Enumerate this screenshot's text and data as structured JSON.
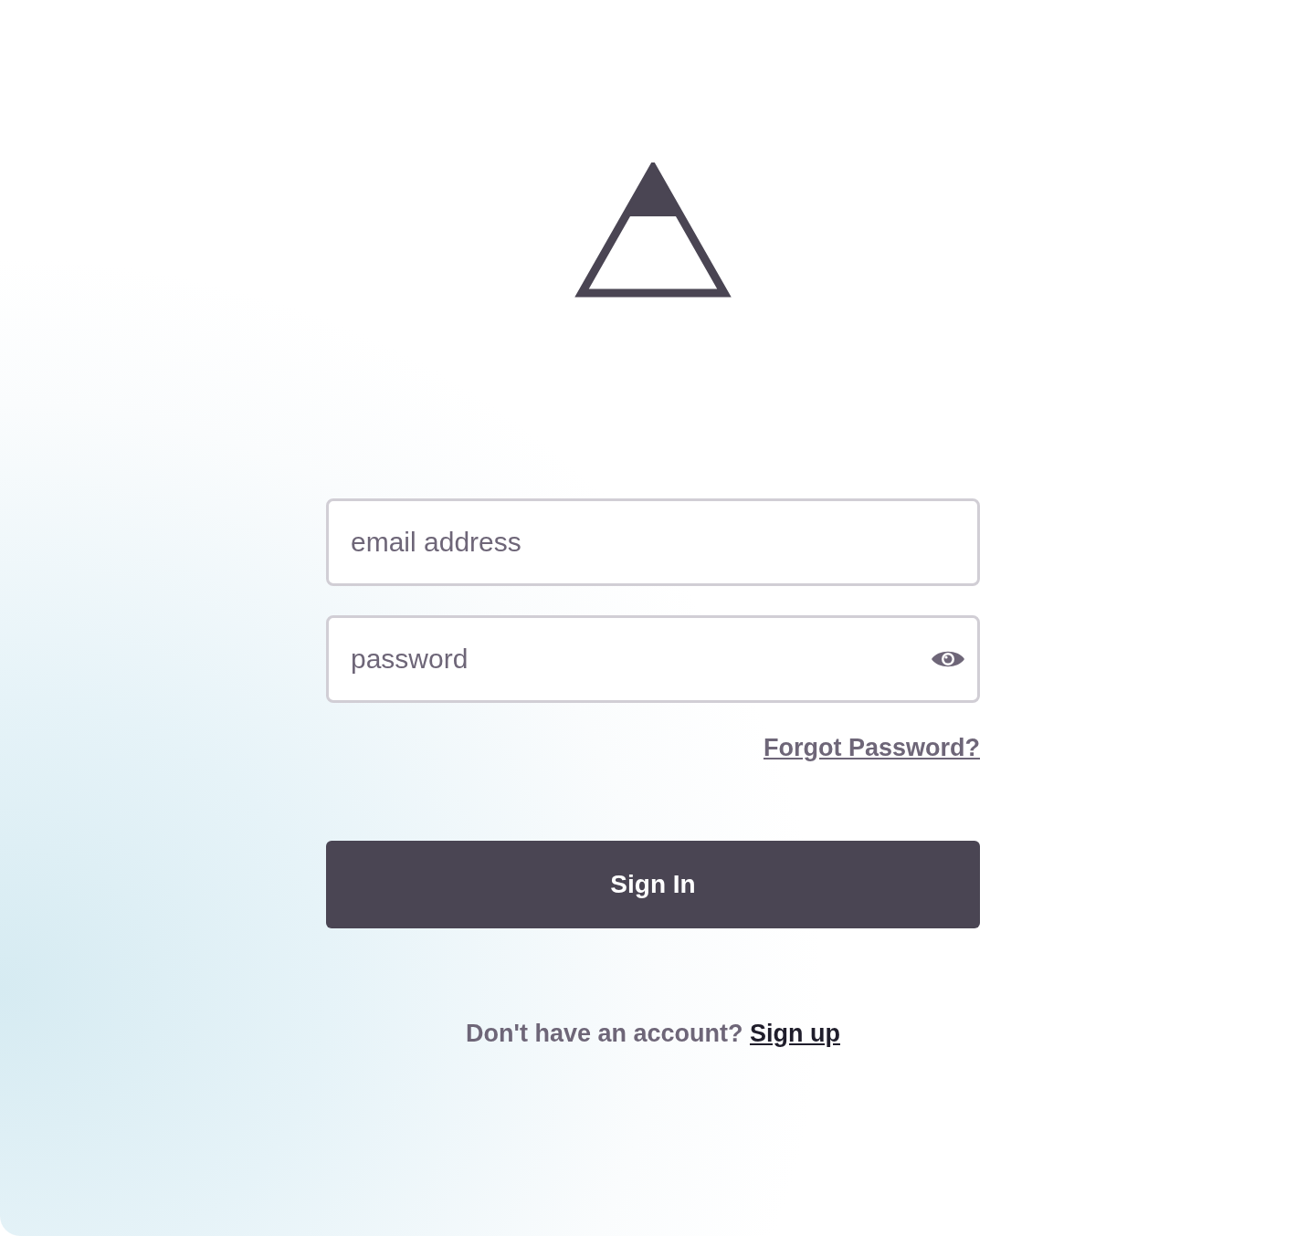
{
  "email_field": {
    "placeholder": "email address"
  },
  "password_field": {
    "placeholder": "password"
  },
  "forgot_password_link": "Forgot Password?",
  "sign_in_button": "Sign In",
  "signup_prompt": {
    "text": "Don't have an account?",
    "link": "Sign up"
  }
}
